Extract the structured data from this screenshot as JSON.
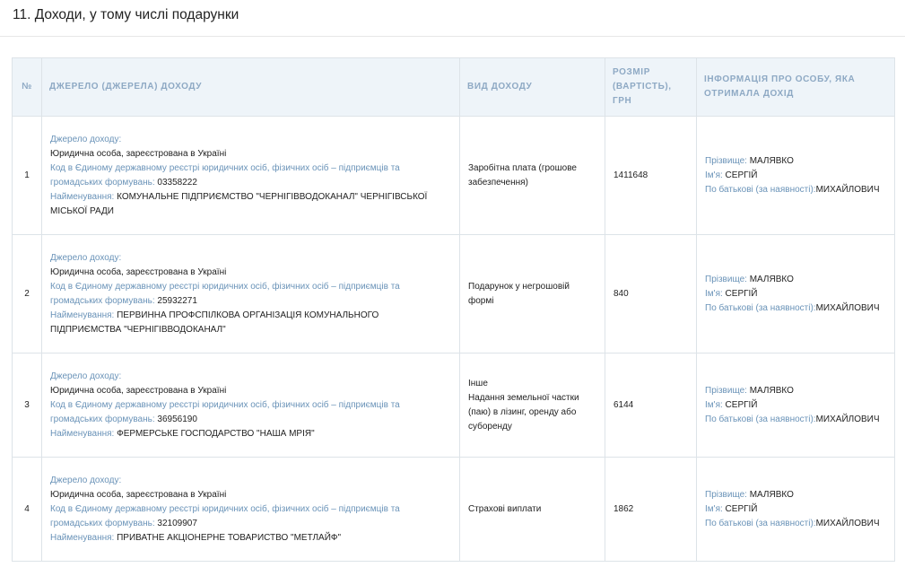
{
  "section_title": "11. Доходи, у тому числі подарунки",
  "headers": {
    "num": "№",
    "source": "ДЖЕРЕЛО (ДЖЕРЕЛА) ДОХОДУ",
    "type": "ВИД ДОХОДУ",
    "amount": "РОЗМІР (ВАРТІСТЬ), ГРН",
    "person": "ІНФОРМАЦІЯ ПРО ОСОБУ, ЯКА ОТРИМАЛА ДОХІД"
  },
  "labels": {
    "source": "Джерело доходу:",
    "code": "Код в Єдиному державному реєстрі юридичних осіб, фізичних осіб – підприємців та громадських формувань:",
    "name": "Найменування:",
    "surname": "Прізвище:",
    "firstname": "Ім'я:",
    "patronymic": "По батькові (за наявності):"
  },
  "rows": [
    {
      "num": "1",
      "source_type": "Юридична особа, зареєстрована в Україні",
      "code": "03358222",
      "name": "КОМУНАЛЬНЕ ПІДПРИЄМСТВО \"ЧЕРНІГІВВОДОКАНАЛ\" ЧЕРНІГІВСЬКОЇ МІСЬКОЇ РАДИ",
      "income_type": "Заробітна плата (грошове забезпечення)",
      "income_type_detail": "",
      "amount": "1411648",
      "surname": "МАЛЯВКО",
      "firstname": "СЕРГІЙ",
      "patronymic": "МИХАЙЛОВИЧ"
    },
    {
      "num": "2",
      "source_type": "Юридична особа, зареєстрована в Україні",
      "code": "25932271",
      "name": "ПЕРВИННА ПРОФСПІЛКОВА ОРГАНІЗАЦІЯ КОМУНАЛЬНОГО ПІДПРИЄМСТВА \"ЧЕРНІГІВВОДОКАНАЛ\"",
      "income_type": "Подарунок у негрошовій формі",
      "income_type_detail": "",
      "amount": "840",
      "surname": "МАЛЯВКО",
      "firstname": "СЕРГІЙ",
      "patronymic": "МИХАЙЛОВИЧ"
    },
    {
      "num": "3",
      "source_type": "Юридична особа, зареєстрована в Україні",
      "code": "36956190",
      "name": "ФЕРМЕРСЬКЕ ГОСПОДАРСТВО \"НАША МРІЯ\"",
      "income_type": "Інше",
      "income_type_detail": "Надання земельної частки (паю) в лізинг, оренду або суборенду",
      "amount": "6144",
      "surname": "МАЛЯВКО",
      "firstname": "СЕРГІЙ",
      "patronymic": "МИХАЙЛОВИЧ"
    },
    {
      "num": "4",
      "source_type": "Юридична особа, зареєстрована в Україні",
      "code": "32109907",
      "name": "ПРИВАТНЕ АКЦІОНЕРНЕ ТОВАРИСТВО \"МЕТЛАЙФ\"",
      "income_type": "Страхові виплати",
      "income_type_detail": "",
      "amount": "1862",
      "surname": "МАЛЯВКО",
      "firstname": "СЕРГІЙ",
      "patronymic": "МИХАЙЛОВИЧ"
    }
  ]
}
